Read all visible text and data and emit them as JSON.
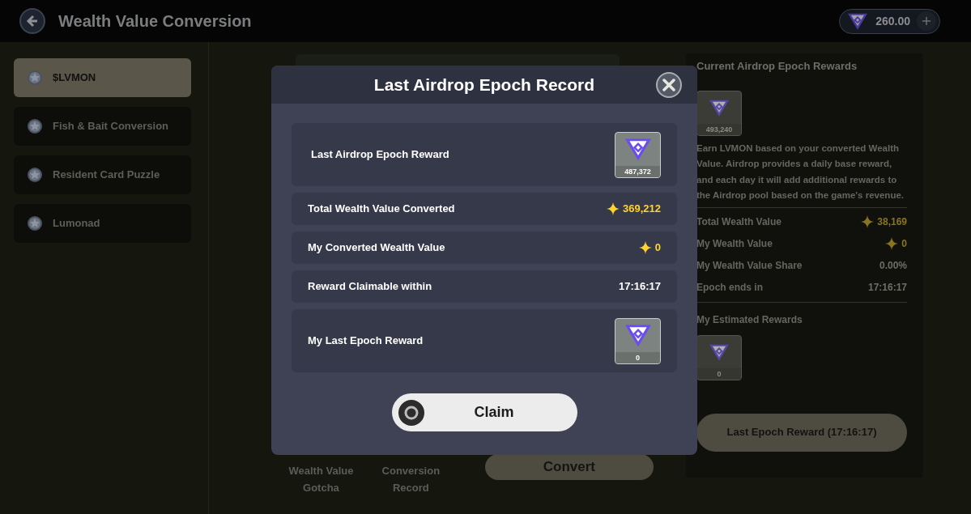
{
  "header": {
    "title": "Wealth Value Conversion",
    "balance": "260.00"
  },
  "sidebar": {
    "items": [
      {
        "label": "$LVMON",
        "selected": true
      },
      {
        "label": "Fish & Bait Conversion",
        "selected": false
      },
      {
        "label": "Resident Card Puzzle",
        "selected": false
      },
      {
        "label": "Lumonad",
        "selected": false
      }
    ]
  },
  "main": {
    "actions": [
      {
        "label": "Wealth Value Gotcha"
      },
      {
        "label": "Conversion Record"
      }
    ],
    "convert_button": "Convert"
  },
  "rewards_panel": {
    "title": "Current Airdrop Epoch Rewards",
    "reward_amount": "493,240",
    "description": "Earn LVMON based on your converted Wealth Value. Airdrop provides a daily base reward, and each day it will add additional rewards to the Airdrop pool based on the game's revenue.",
    "stats": [
      {
        "label": "Total Wealth Value",
        "value": "38,169",
        "kind": "wealth"
      },
      {
        "label": "My Wealth Value",
        "value": "0",
        "kind": "wealth"
      },
      {
        "label": "My Wealth Value Share",
        "value": "0.00%",
        "kind": "plain"
      },
      {
        "label": "Epoch ends in",
        "value": "17:16:17",
        "kind": "plain"
      }
    ],
    "estimated_title": "My Estimated Rewards",
    "estimated_amount": "0",
    "button": "Last Epoch Reward (17:16:17)"
  },
  "modal": {
    "title": "Last Airdrop Epoch Record",
    "rows": [
      {
        "kind": "token",
        "label": "Last Airdrop Epoch Reward",
        "value": "487,372"
      },
      {
        "kind": "wealth",
        "label": "Total Wealth Value Converted",
        "value": "369,212"
      },
      {
        "kind": "wealth",
        "label": "My Converted Wealth Value",
        "value": "0"
      },
      {
        "kind": "plain",
        "label": "Reward Claimable within",
        "value": "17:16:17"
      },
      {
        "kind": "token",
        "label": "My Last Epoch Reward",
        "value": "0"
      }
    ],
    "claim_button": "Claim"
  }
}
